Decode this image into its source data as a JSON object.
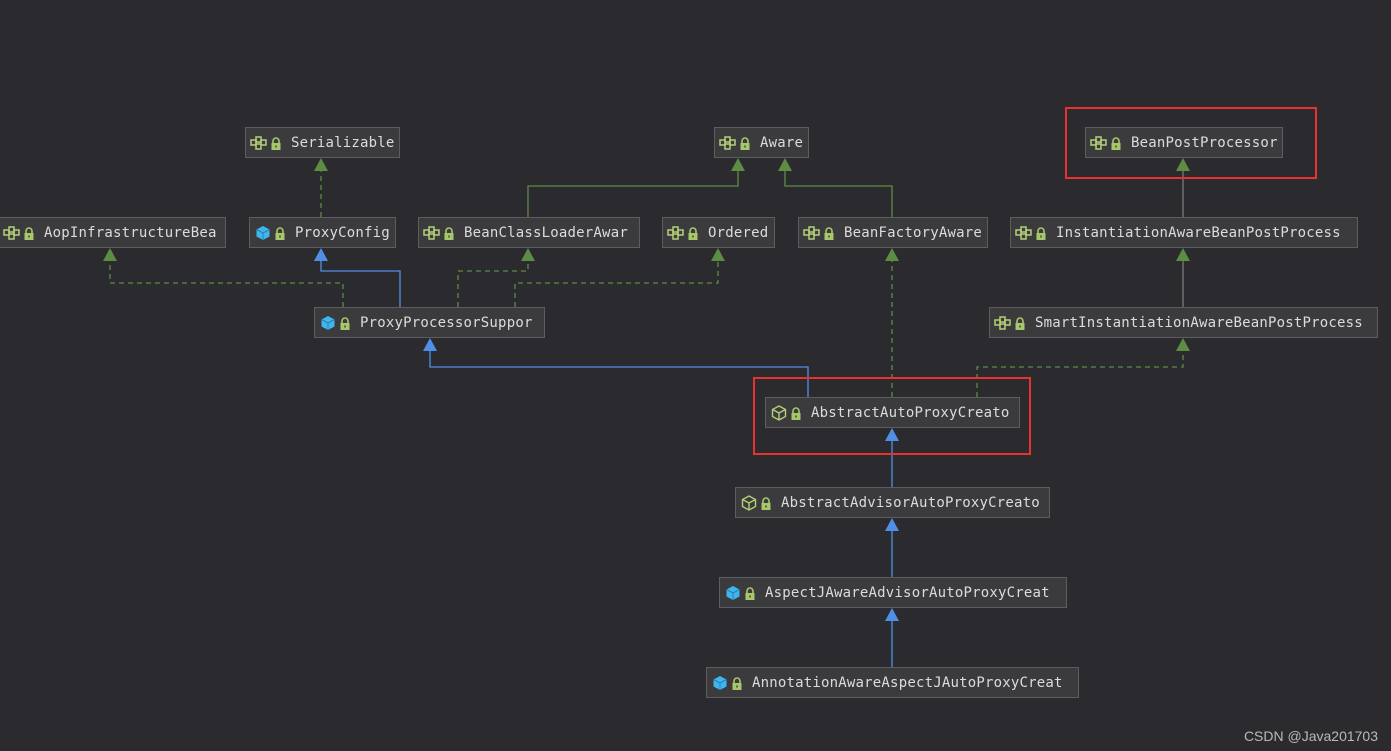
{
  "diagram": {
    "nodes": {
      "serializable": {
        "label": "Serializable",
        "kind": "interface"
      },
      "aware": {
        "label": "Aware",
        "kind": "interface"
      },
      "bean_post_processor": {
        "label": "BeanPostProcessor",
        "kind": "interface",
        "highlighted": true
      },
      "aop_infrastructure_bean": {
        "label": "AopInfrastructureBea",
        "kind": "interface"
      },
      "proxy_config": {
        "label": "ProxyConfig",
        "kind": "class"
      },
      "bean_class_loader_aware": {
        "label": "BeanClassLoaderAwar",
        "kind": "interface"
      },
      "ordered": {
        "label": "Ordered",
        "kind": "interface"
      },
      "bean_factory_aware": {
        "label": "BeanFactoryAware",
        "kind": "interface"
      },
      "instantiation_aware_bpp": {
        "label": "InstantiationAwareBeanPostProcess",
        "kind": "interface"
      },
      "proxy_processor_support": {
        "label": "ProxyProcessorSuppor",
        "kind": "class"
      },
      "smart_instantiation_aware_bpp": {
        "label": "SmartInstantiationAwareBeanPostProcess",
        "kind": "interface"
      },
      "abstract_auto_proxy_creator": {
        "label": "AbstractAutoProxyCreato",
        "kind": "abstract-class",
        "highlighted": true
      },
      "abstract_advisor_auto_proxy_creator": {
        "label": "AbstractAdvisorAutoProxyCreato",
        "kind": "abstract-class"
      },
      "aspectj_aware_advisor_auto_proxy_creator": {
        "label": "AspectJAwareAdvisorAutoProxyCreat",
        "kind": "class"
      },
      "annotation_aware_aspectj_auto_proxy_creator": {
        "label": "AnnotationAwareAspectJAutoProxyCreat",
        "kind": "class"
      }
    },
    "colors": {
      "background": "#2b2a2e",
      "extends": "#4f8fe6",
      "implements": "#5d8c45",
      "interface_extends_line": "#7a7a7a",
      "highlight": "#e8322f"
    }
  },
  "watermark": "CSDN @Java201703"
}
